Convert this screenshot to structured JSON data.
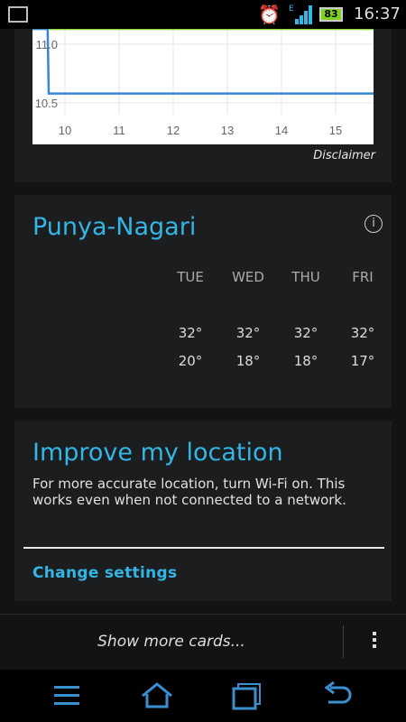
{
  "status_bar": {
    "time": "16:37",
    "battery": "83",
    "network_type": "E"
  },
  "chart_card": {
    "disclaimer": "Disclaimer",
    "chart_data": {
      "type": "line",
      "x_ticks": [
        "10",
        "11",
        "12",
        "13",
        "14",
        "15"
      ],
      "y_ticks": [
        "11.0",
        "10.5"
      ],
      "series": [
        {
          "color": "#8cd33b",
          "x": [
            9.4,
            15.7
          ],
          "y": [
            11.13,
            11.13
          ]
        },
        {
          "color": "#3a86d6",
          "x": [
            9.4,
            9.68,
            9.7,
            15.7
          ],
          "y": [
            11.13,
            11.13,
            10.58,
            10.58
          ]
        }
      ],
      "ylim": [
        10.4,
        11.13
      ]
    }
  },
  "weather": {
    "city": "Punya-Nagari",
    "info_icon": "info-icon",
    "days": [
      {
        "name": "TUE",
        "high": "32°",
        "low": "20°"
      },
      {
        "name": "WED",
        "high": "32°",
        "low": "18°"
      },
      {
        "name": "THU",
        "high": "32°",
        "low": "18°"
      },
      {
        "name": "FRI",
        "high": "32°",
        "low": "17°"
      }
    ]
  },
  "location_card": {
    "title": "Improve my location",
    "description": "For more accurate location, turn Wi-Fi on. This works even when not connected to a network.",
    "action": "Change settings"
  },
  "bottom": {
    "show_more": "Show more cards..."
  },
  "colors": {
    "accent": "#33b5e5",
    "background": "#121314",
    "card": "#1c1d1f"
  }
}
